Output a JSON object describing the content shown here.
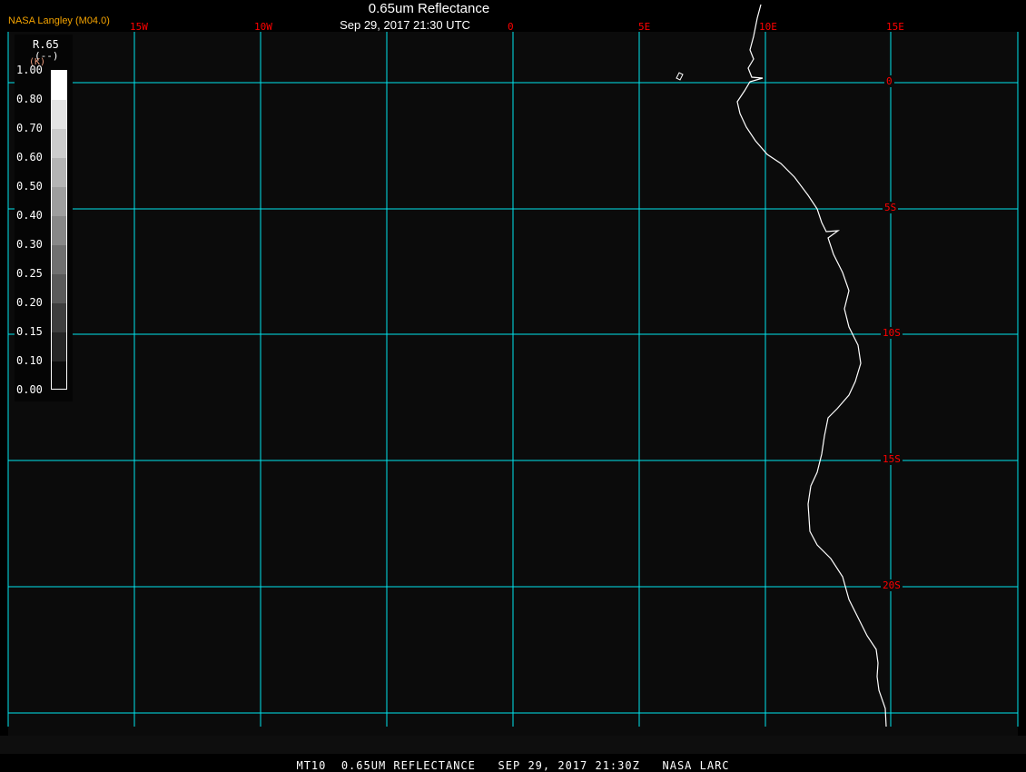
{
  "header": {
    "brand": "NASA Langley (M04.0)",
    "title": "0.65um Reflectance",
    "subtitle": "Sep 29, 2017 21:30 UTC"
  },
  "grid": {
    "color": "#00e5ee",
    "longitude_labels": [
      "15W",
      "10W",
      "0",
      "5E",
      "10E",
      "15E"
    ],
    "latitude_labels": [
      "0",
      "5S",
      "10S",
      "15S",
      "20S"
    ]
  },
  "legend": {
    "variable": "R.65",
    "units": "(--)",
    "units_overlay": "(K)",
    "ticks": [
      "1.00",
      "0.80",
      "0.70",
      "0.60",
      "0.50",
      "0.40",
      "0.30",
      "0.25",
      "0.20",
      "0.15",
      "0.10",
      "0.00"
    ]
  },
  "colors": {
    "label": "#ff0000",
    "brand": "#f4a300",
    "coastline": "#ffffff",
    "background": "#0b0b0b"
  },
  "footer": {
    "caption": "MT10  0.65UM REFLECTANCE   SEP 29, 2017 21:30Z   NASA LARC"
  }
}
